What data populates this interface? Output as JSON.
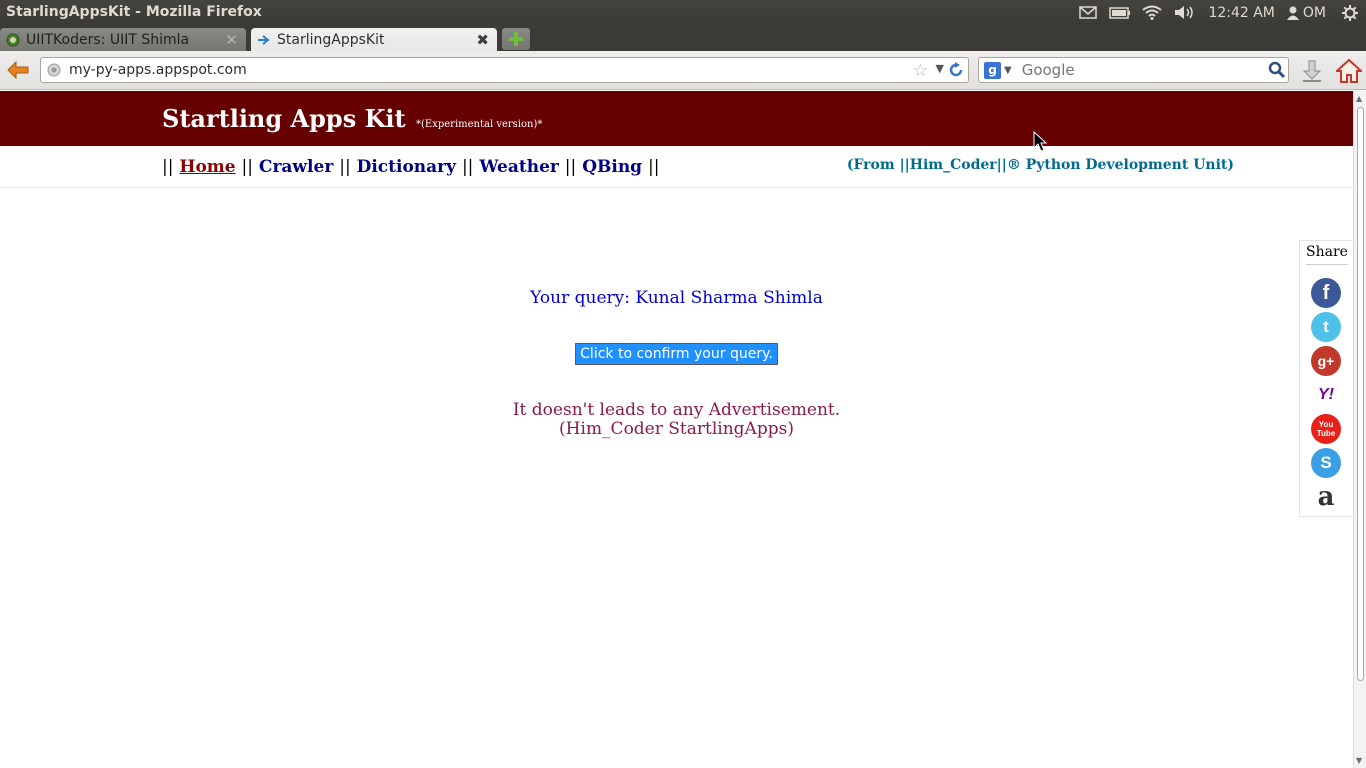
{
  "os": {
    "window_title": "StarlingAppsKit - Mozilla Firefox",
    "clock": "12:42 AM",
    "user": "OM",
    "tray_icons": [
      "mail-icon",
      "battery-icon",
      "wifi-icon",
      "volume-icon",
      "user-icon",
      "settings-gear-icon"
    ]
  },
  "browser": {
    "tabs": [
      {
        "label": "UIITKoders: UIIT Shimla",
        "active": false
      },
      {
        "label": "StarlingAppsKit",
        "active": true
      }
    ],
    "url": "my-py-apps.appspot.com",
    "search_engine": "Google",
    "search_placeholder": "Google"
  },
  "site": {
    "title": "Startling Apps Kit",
    "subtitle": "*(Experimental version)*",
    "nav": {
      "sep": "||",
      "items": [
        "Home",
        "Crawler",
        "Dictionary",
        "Weather",
        "QBing"
      ]
    },
    "credit": "(From ||Him_Coder||® Python Development Unit)",
    "query_text": "Your query: Kunal Sharma Shimla",
    "confirm_button": "Click to confirm your query.",
    "notice_line1": "It doesn't leads to any Advertisement.",
    "notice_line2": "(Him_Coder StartlingApps)",
    "share": {
      "label": "Share",
      "services": [
        {
          "name": "facebook",
          "glyph": "f",
          "color": "#3b5998"
        },
        {
          "name": "twitter",
          "glyph": "t",
          "color": "#4fc0e8"
        },
        {
          "name": "google-plus",
          "glyph": "g+",
          "color": "#c0392b"
        },
        {
          "name": "yahoo",
          "glyph": "Y!",
          "color": "#7b0099"
        },
        {
          "name": "youtube",
          "glyph": "You Tube",
          "color": "#e62117"
        },
        {
          "name": "skype",
          "glyph": "S",
          "color": "#3b9fe4"
        },
        {
          "name": "amazon",
          "glyph": "a",
          "color": "#333333"
        }
      ]
    }
  },
  "colors": {
    "header_bg": "#660000",
    "nav_link": "#000080",
    "nav_current": "#8b0000",
    "credit": "#006b8f",
    "query": "#0000cd",
    "button_bg": "#1e90ff",
    "notice": "#8b1a4b"
  }
}
